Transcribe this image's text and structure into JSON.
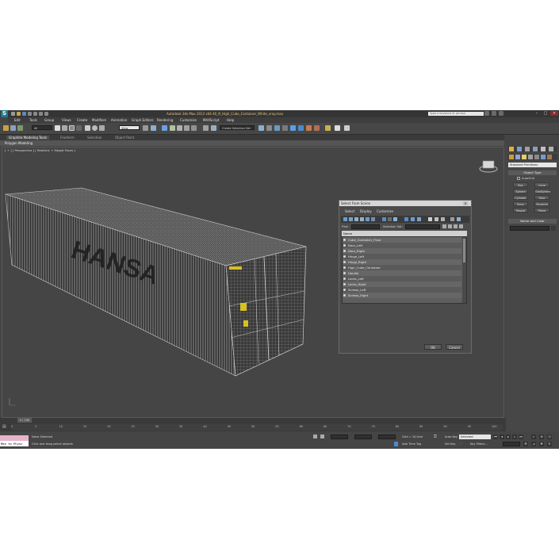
{
  "window": {
    "title": "Autodesk 3ds Max  2012 x64     40_ft_High_Cube_Container_White_vray.max",
    "search_placeholder": "Type a keyword or phrase",
    "logo_text": "S"
  },
  "menubar": [
    "Edit",
    "Tools",
    "Group",
    "Views",
    "Create",
    "Modifiers",
    "Animation",
    "Graph Editors",
    "Rendering",
    "Customize",
    "MAXScript",
    "Help"
  ],
  "toolbar": {
    "selection_filter": "All",
    "ref_coord": "View",
    "named_selection": "Create Selection Set"
  },
  "ribbon": {
    "tabs": [
      "Graphite Modeling Tools",
      "Freeform",
      "Selection",
      "Object Paint"
    ],
    "panel_label": "Polygon Modeling"
  },
  "viewport": {
    "label": "[ + ] [ Perspective ] [ Realistic + Edged Faces ]",
    "container_lettering": "HANSA"
  },
  "command_panel": {
    "category": "Standard Primitives",
    "rollout_object_type": "Object Type",
    "autogrid_label": "AutoGrid",
    "buttons": [
      "Box",
      "Cone",
      "Sphere",
      "GeoSphere",
      "Cylinder",
      "Tube",
      "Torus",
      "Pyramid",
      "Teapot",
      "Plane"
    ],
    "rollout_name_color": "Name and Color"
  },
  "dialog": {
    "title": "Select From Scene",
    "menu": [
      "Select",
      "Display",
      "Customize"
    ],
    "find_label": "Find:",
    "selection_set_label": "Selection Set:",
    "column_header": "Name",
    "items": [
      "Cube_Container_Floor",
      "Door_Left",
      "Door_Right",
      "Hinge_Left",
      "Hinge_Right",
      "High_Cube_Container",
      "Handle",
      "Locks_Left",
      "Locks_Right",
      "Screws_Left",
      "Screws_Right"
    ],
    "ok_label": "OK",
    "cancel_label": "Cancel"
  },
  "timeline": {
    "frame_display": "0 / 100",
    "ticks": [
      "0",
      "5",
      "10",
      "15",
      "20",
      "25",
      "30",
      "35",
      "40",
      "45",
      "50",
      "55",
      "60",
      "65",
      "70",
      "75",
      "80",
      "85",
      "90",
      "95",
      "100"
    ]
  },
  "statusbar": {
    "script_text": "Max to Physc",
    "selection_status": "None Selected",
    "prompt": "Click and drag-select objects",
    "grid": "Grid = 10,0cm",
    "add_time_tag": "Add Time Tag",
    "auto_key": "Auto Key",
    "auto_key_mode": "Selected",
    "set_key": "Set Key",
    "key_filters": "Key Filters..."
  }
}
